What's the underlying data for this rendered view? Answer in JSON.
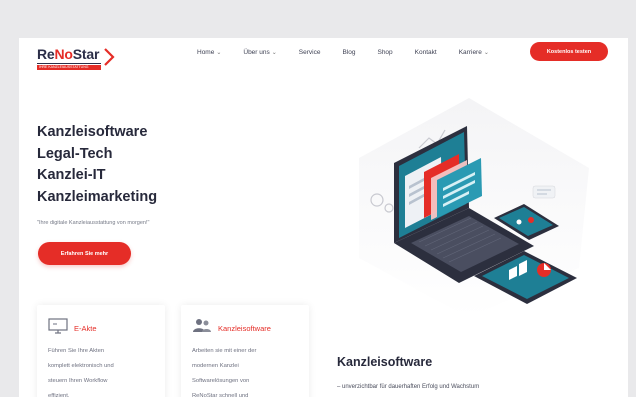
{
  "logo": {
    "brand_part1": "Re",
    "brand_part2": "No",
    "brand_part3": "Star",
    "subline": "IHRE KANZLEIAUSSTATTUNG"
  },
  "nav": {
    "items": [
      {
        "label": "Home",
        "has_dropdown": true
      },
      {
        "label": "Über uns",
        "has_dropdown": true
      },
      {
        "label": "Service",
        "has_dropdown": false
      },
      {
        "label": "Blog",
        "has_dropdown": false
      },
      {
        "label": "Shop",
        "has_dropdown": false
      },
      {
        "label": "Kontakt",
        "has_dropdown": false
      },
      {
        "label": "Karriere",
        "has_dropdown": true
      }
    ],
    "dropdown_icon": "chevron-down-icon",
    "cta_label": "Kostenlos testen"
  },
  "hero": {
    "lines": [
      "Kanzleisoftware",
      "Legal-Tech",
      "Kanzlei-IT",
      "Kanzleimarketing"
    ],
    "tagline": "\"Ihre digitale Kanzleiausstattung von morgen!\"",
    "button_label": "Erfahren Sie mehr"
  },
  "cards": [
    {
      "icon": "monitor-icon",
      "title": "E-Akte",
      "lines": [
        "Führen Sie Ihre Akten",
        "komplett elektronisch und",
        "steuern Ihren Workflow",
        "effizient."
      ]
    },
    {
      "icon": "users-icon",
      "title": "Kanzleisoftware",
      "lines": [
        "Arbeiten sie mit einer der",
        "modernen Kanzlei",
        "Softwarelösungen von",
        "ReNoStar schnell und"
      ]
    }
  ],
  "section": {
    "title": "Kanzleisoftware",
    "subtitle": "– unverzichtbar für dauerhaften Erfolg und Wachstum"
  },
  "colors": {
    "accent": "#e52d27",
    "navy": "#2b2e48",
    "teal": "#1e7f95",
    "background": "#e9e9eb"
  }
}
